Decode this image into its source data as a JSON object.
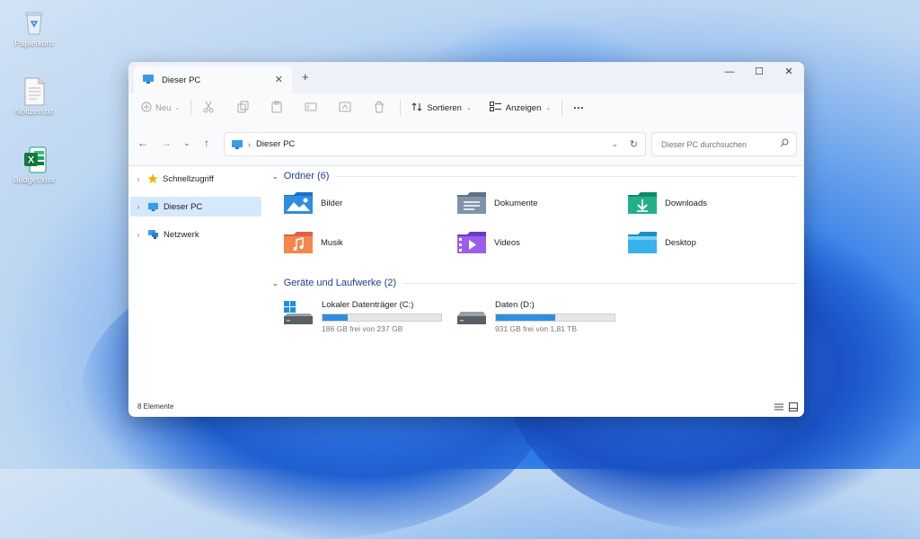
{
  "desktop": {
    "icons": [
      {
        "label": "Papierkorb",
        "icon": "recycle-bin-icon"
      },
      {
        "label": "Notizen.txt",
        "icon": "text-file-icon"
      },
      {
        "label": "Budget.xlsx",
        "icon": "excel-file-icon"
      }
    ]
  },
  "window": {
    "tab_title": "Dieser PC",
    "new_tab": "+",
    "controls": {
      "minimize": "—",
      "maximize": "☐",
      "close": "✕"
    }
  },
  "toolbar": {
    "new_label": "Neu",
    "sort_label": "Sortieren",
    "view_label": "Anzeigen",
    "more_label": "···"
  },
  "address": {
    "path": "Dieser PC",
    "search_placeholder": "Dieser PC durchsuchen"
  },
  "sidebar": {
    "items": [
      {
        "label": "Schnellzugriff",
        "icon": "star-icon"
      },
      {
        "label": "Dieser PC",
        "icon": "computer-icon",
        "selected": true
      },
      {
        "label": "Netzwerk",
        "icon": "network-icon"
      }
    ]
  },
  "content": {
    "folders_header": "Ordner (6)",
    "folders": [
      {
        "label": "Bilder",
        "icon": "pictures-folder-icon"
      },
      {
        "label": "Dokumente",
        "icon": "documents-folder-icon"
      },
      {
        "label": "Downloads",
        "icon": "downloads-folder-icon"
      },
      {
        "label": "Musik",
        "icon": "music-folder-icon"
      },
      {
        "label": "Videos",
        "icon": "videos-folder-icon"
      },
      {
        "label": "Desktop",
        "icon": "desktop-folder-icon"
      }
    ],
    "drives_header": "Geräte und Laufwerke (2)",
    "drives": [
      {
        "label": "Lokaler Datenträger (C:)",
        "free_text": "186 GB frei von 237 GB",
        "used_fraction": 0.215
      },
      {
        "label": "Daten (D:)",
        "free_text": "931 GB frei von 1,81 TB",
        "used_fraction": 0.5
      }
    ]
  },
  "status": {
    "count": "8 Elemente"
  },
  "colors": {
    "accent": "#2f8ee0",
    "selection": "#d6e8fb",
    "group_header": "#1e3f8a"
  }
}
